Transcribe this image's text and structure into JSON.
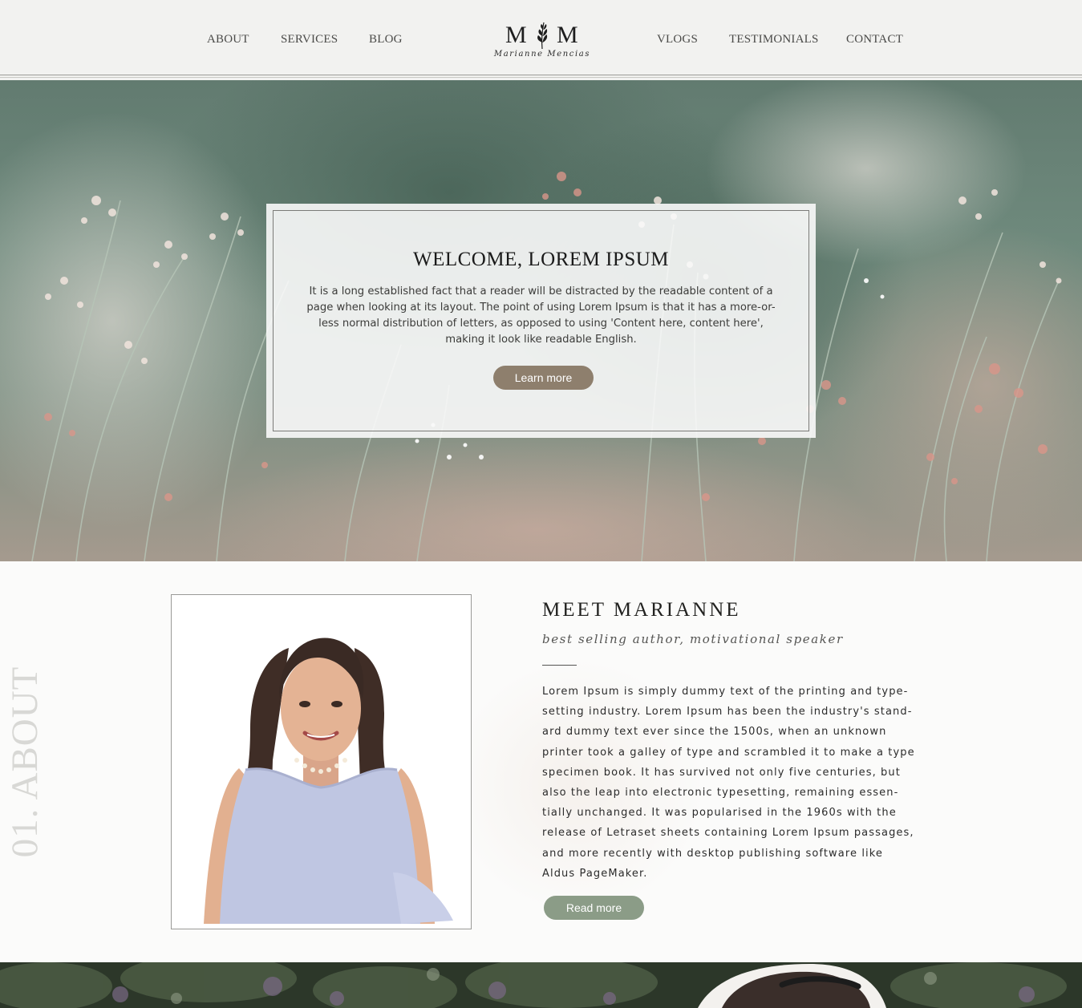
{
  "nav": {
    "left": [
      "ABOUT",
      "SERVICES",
      "BLOG"
    ],
    "right": [
      "VLOGS",
      "TESTIMONIALS",
      "CONTACT"
    ]
  },
  "logo": {
    "monogram_left": "M",
    "monogram_right": "M",
    "name": "Marianne Mencias",
    "icon": "leaf-icon"
  },
  "hero": {
    "title": "WELCOME, LOREM IPSUM",
    "body": "It is a long established fact that a reader will be distracted by the readable content of a page when looking at its layout. The point of using Lorem Ipsum is that it has a more-or-less normal distribution of letters, as opposed to using 'Content here, content here', making it look like readable English.",
    "button": "Learn more",
    "button_color": "#8e7f6d"
  },
  "about": {
    "side_label": "01. ABOUT",
    "heading": "MEET MARIANNE",
    "subtitle": "best selling author, motivational speaker",
    "body": "Lorem Ipsum is simply dummy text of the printing and type-setting industry. Lorem Ipsum has been the industry's stand-ard dummy text ever since the 1500s, when an unknown printer took a galley of type and scrambled it to make a type specimen book. It has survived not only five centuries, but also the leap into electronic typesetting, remaining essen-tially unchanged. It was popularised in the 1960s with the release of Letraset sheets containing Lorem Ipsum passages, and more recently with desktop publishing software like Aldus PageMaker.",
    "button": "Read more",
    "button_color": "#8b9c87"
  }
}
